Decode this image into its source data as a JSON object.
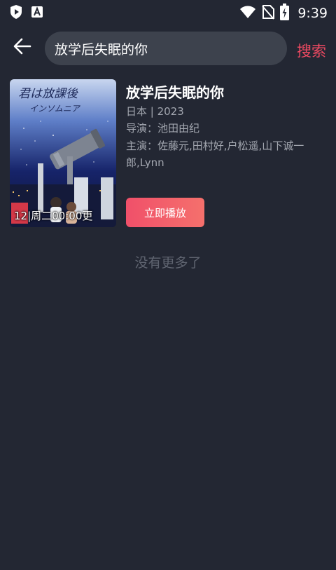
{
  "status_bar": {
    "left_icons": [
      "play-shield-icon",
      "a-app-icon"
    ],
    "right_icons": [
      "wifi-icon",
      "no-sim-icon",
      "battery-charging-icon"
    ],
    "time": "9:39"
  },
  "header": {
    "back_icon": "arrow-left-icon",
    "search_query": "放学后失眠的你",
    "search_button": "搜索"
  },
  "result": {
    "title": "放学后失眠的你",
    "region_year": "日本 | 2023",
    "director": "导演：池田由纪",
    "cast": "主演：佐藤元,田村好,户松遥,山下诚一郎,Lynn",
    "poster_badge": "12|周二00:00更",
    "poster_title_art": "君は放課後インソムニア",
    "play_button": "立即播放"
  },
  "footer_text": "没有更多了",
  "colors": {
    "background": "#232733",
    "search_box": "#3d424d",
    "accent": "#ef4a62",
    "muted_text": "#a3a7b0"
  }
}
